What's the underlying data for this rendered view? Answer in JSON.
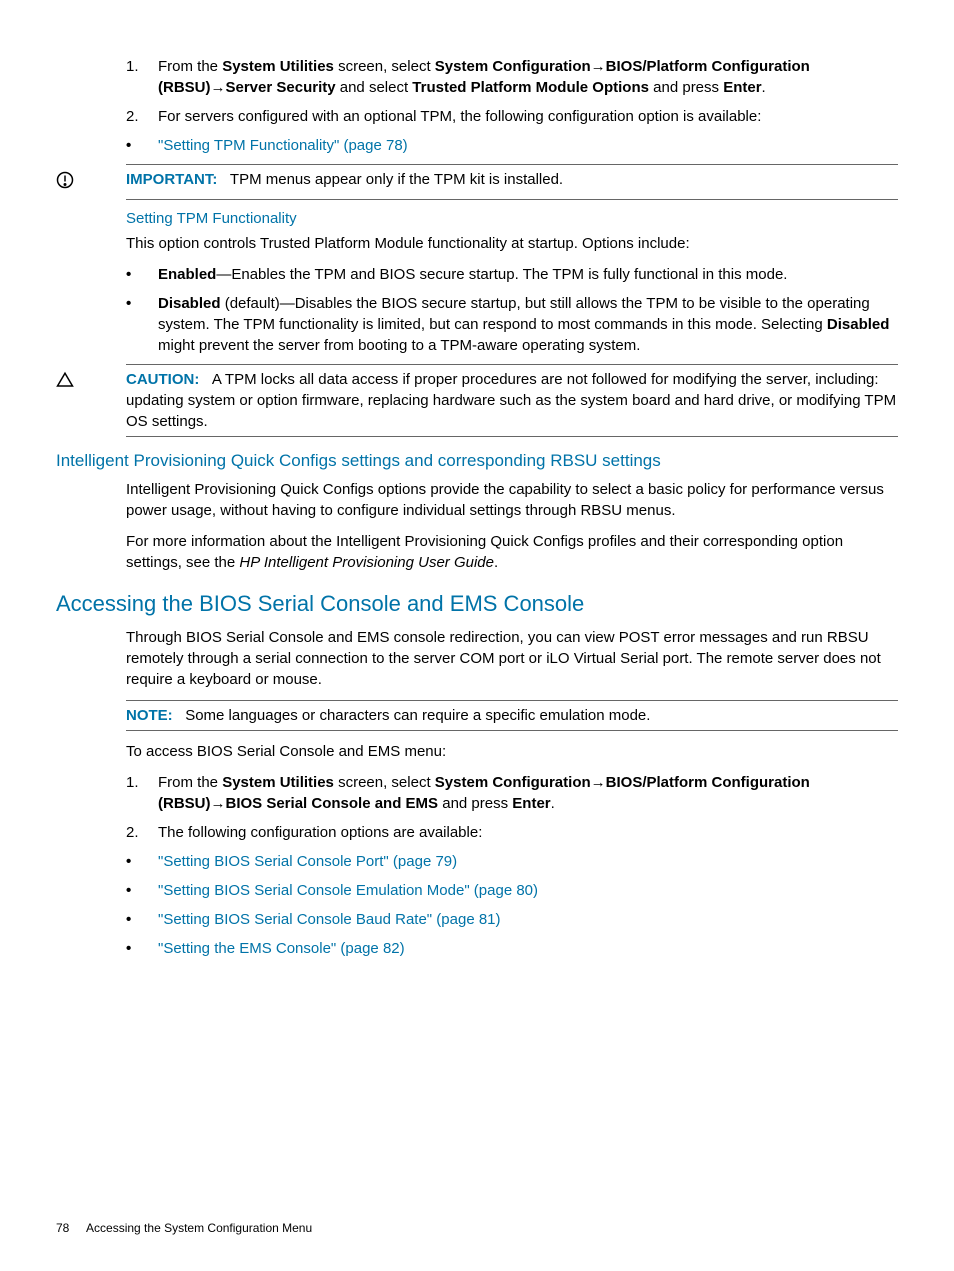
{
  "step1": {
    "pre": "From the ",
    "b1": "System Utilities",
    "mid1": " screen, select ",
    "b2": "System Configuration",
    "arrow": "→",
    "b3": "BIOS/Platform Configuration (RBSU)",
    "b4": "Server Security",
    "mid2": " and select ",
    "b5": "Trusted Platform Module Options",
    "mid3": " and press ",
    "b6": "Enter",
    "end": "."
  },
  "step2": "For servers configured with an optional TPM, the following configuration option is available:",
  "link_tpm_func": "\"Setting TPM Functionality\" (page 78)",
  "important": {
    "label": "IMPORTANT:",
    "text": "TPM menus appear only if the TPM kit is installed."
  },
  "h_tpm_func": "Setting TPM Functionality",
  "tpm_intro": "This option controls Trusted Platform Module functionality at startup. Options include:",
  "tpm_enabled": {
    "b": "Enabled",
    "rest": "—Enables the TPM and BIOS secure startup. The TPM is fully functional in this mode."
  },
  "tpm_disabled": {
    "b1": "Disabled",
    "mid1": " (default)—Disables the BIOS secure startup, but still allows the TPM to be visible to the operating system. The TPM functionality is limited, but can respond to most commands in this mode. Selecting ",
    "b2": "Disabled",
    "mid2": " might prevent the server from booting to a TPM-aware operating system."
  },
  "caution": {
    "label": "CAUTION:",
    "text": "A TPM locks all data access if proper procedures are not followed for modifying the server, including: updating system or option firmware, replacing hardware such as the system board and hard drive, or modifying TPM OS settings."
  },
  "h_ip": "Intelligent Provisioning Quick Configs settings and corresponding RBSU settings",
  "ip_p1": "Intelligent Provisioning Quick Configs options provide the capability to select a basic policy for performance versus power usage, without having to configure individual settings through RBSU menus.",
  "ip_p2_pre": "For more information about the Intelligent Provisioning Quick Configs profiles and their corresponding option settings, see the ",
  "ip_p2_i": "HP Intelligent Provisioning User Guide",
  "ip_p2_end": ".",
  "h_bios": "Accessing the BIOS Serial Console and EMS Console",
  "bios_p1": "Through BIOS Serial Console and EMS console redirection, you can view POST error messages and run RBSU remotely through a serial connection to the server COM port or iLO Virtual Serial port. The remote server does not require a keyboard or mouse.",
  "note": {
    "label": "NOTE:",
    "text": "Some languages or characters can require a specific emulation mode."
  },
  "bios_p2": "To access BIOS Serial Console and EMS menu:",
  "bstep1": {
    "pre": "From the ",
    "b1": "System Utilities",
    "mid1": " screen, select ",
    "b2": "System Configuration",
    "arrow": "→",
    "b3": "BIOS/Platform Configuration (RBSU)",
    "b4": "BIOS Serial Console and EMS",
    "mid2": " and press ",
    "b5": "Enter",
    "end": "."
  },
  "bstep2": "The following configuration options are available:",
  "blinks": [
    "\"Setting BIOS Serial Console Port\" (page 79)",
    "\"Setting BIOS Serial Console Emulation Mode\" (page 80)",
    "\"Setting BIOS Serial Console Baud Rate\" (page 81)",
    "\"Setting the EMS Console\" (page 82)"
  ],
  "footer": {
    "page": "78",
    "title": "Accessing the System Configuration Menu"
  }
}
